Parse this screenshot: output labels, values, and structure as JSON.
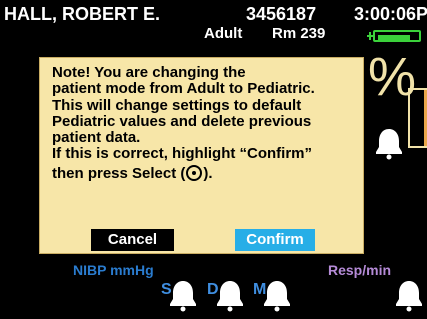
{
  "header": {
    "patient_name": "HALL, ROBERT E.",
    "patient_id": "3456187",
    "patient_type": "Adult",
    "room": "Rm 239",
    "clock": "3:00:06P",
    "battery_level": 0.75
  },
  "background": {
    "percent": "%",
    "nibp_label": "NIBP mmHg",
    "resp_label": "Resp/min",
    "nibp_modes": [
      "S",
      "D",
      "M"
    ],
    "alarm_icon": "bell-icon"
  },
  "dialog": {
    "line_1": "Note! You are changing the",
    "line_2": "patient mode from Adult to Pediatric.",
    "line_3": "This will change settings to default",
    "line_4": "Pediatric values and delete previous",
    "line_5": "patient data.",
    "line_6": "If this is correct, highlight “Confirm”",
    "line_7_prefix": "then press Select (",
    "line_7_suffix": ").",
    "select_icon": "select-button-icon",
    "cancel_label": "Cancel",
    "confirm_label": "Confirm",
    "colors": {
      "background": "#f7e6a8",
      "cancel": "#000000",
      "confirm": "#27aee7"
    }
  }
}
